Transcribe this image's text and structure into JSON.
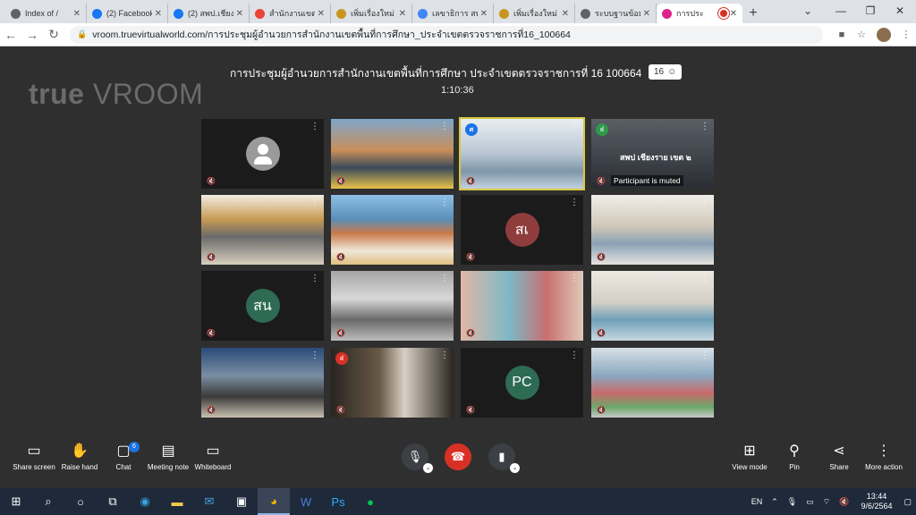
{
  "browser": {
    "tabs": [
      {
        "title": "Index of /",
        "icon": "globe-icon",
        "color": "#5f6368"
      },
      {
        "title": "(2) Facebook",
        "icon": "facebook-icon",
        "color": "#1877f2"
      },
      {
        "title": "(2) สพป.เชียง",
        "icon": "facebook-icon",
        "color": "#1877f2"
      },
      {
        "title": "สำนักงานเขต",
        "icon": "gmail-icon",
        "color": "#ea4335"
      },
      {
        "title": "เพิ่มเรื่องใหม่",
        "icon": "seal-icon",
        "color": "#c8961e"
      },
      {
        "title": "เลขาธิการ สพ",
        "icon": "google-icon",
        "color": "#4285f4"
      },
      {
        "title": "เพิ่มเรื่องใหม่",
        "icon": "seal-icon",
        "color": "#c8961e"
      },
      {
        "title": "ระบบฐานข้อมู",
        "icon": "globe-icon",
        "color": "#5f6368"
      },
      {
        "title": "การประ",
        "icon": "vroom-icon",
        "color": "#e0218a",
        "active": true
      }
    ],
    "new_tab": "+",
    "url": "vroom.truevirtualworld.com/การประชุมผู้อำนวยการสำนักงานเขตพื้นที่การศึกษา_ประจำเขตตรวจราชการที่16_100664"
  },
  "meeting": {
    "logo_bold": "true",
    "logo_thin": " VROOM",
    "title": "การประชุมผู้อำนวยการสำนักงานเขตพื้นที่การศึกษา ประจำเขตตรวจราชการที่ 16 100664",
    "participant_count": "16",
    "elapsed": "1:10:36",
    "tiles": [
      {
        "type": "avatar"
      },
      {
        "type": "video",
        "bg": "#6a7f8f",
        "scene": "stage"
      },
      {
        "type": "video",
        "bg": "#c9d4dc",
        "scene": "office",
        "speaking": true,
        "signal": "ศ"
      },
      {
        "type": "video",
        "bg": "#4a4a4a",
        "scene": "dark",
        "name": "สพป เชียงราย เขต ๒",
        "muted_label": "Participant is muted",
        "signal": "ıl"
      },
      {
        "type": "video",
        "bg": "#b8a27a",
        "scene": "room"
      },
      {
        "type": "video",
        "bg": "#6f8fa6",
        "scene": "mural"
      },
      {
        "type": "initials",
        "initials": "สเ",
        "color": "#8f3c3c"
      },
      {
        "type": "video",
        "bg": "#d6d3cd",
        "scene": "shelf"
      },
      {
        "type": "initials",
        "initials": "สน",
        "color": "#2e6b54"
      },
      {
        "type": "video",
        "bg": "#8b8b8b",
        "scene": "class"
      },
      {
        "type": "video",
        "bg": "#c7a58f",
        "scene": "people"
      },
      {
        "type": "video",
        "bg": "#e5e0d8",
        "scene": "mask"
      },
      {
        "type": "video",
        "bg": "#58677a",
        "scene": "desk"
      },
      {
        "type": "video",
        "bg": "#5a4f42",
        "scene": "portrait",
        "signal": "ıl"
      },
      {
        "type": "initials",
        "initials": "PC",
        "color": "#2e6b54"
      },
      {
        "type": "video",
        "bg": "#a9b9c3",
        "scene": "hall"
      }
    ]
  },
  "controls": {
    "share_screen": "Share screen",
    "raise_hand": "Raise hand",
    "chat": "Chat",
    "chat_badge": "6",
    "meeting_note": "Meeting note",
    "whiteboard": "Whiteboard",
    "view_mode": "View mode",
    "pin": "Pin",
    "share": "Share",
    "more_action": "More action"
  },
  "taskbar": {
    "lang": "EN",
    "time": "13:44",
    "date": "9/6/2564"
  }
}
